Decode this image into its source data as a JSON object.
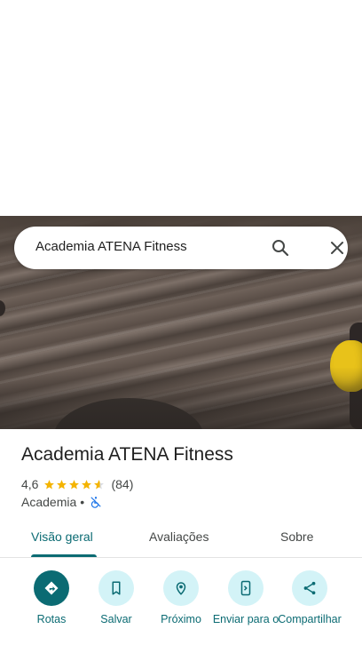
{
  "search": {
    "query": "Academia ATENA Fitness"
  },
  "place": {
    "name": "Academia ATENA Fitness",
    "rating": "4,6",
    "rating_value": 4.6,
    "stars_max": 5,
    "review_count": "(84)",
    "category": "Academia",
    "separator": "•"
  },
  "tabs": [
    {
      "label": "Visão geral",
      "active": true
    },
    {
      "label": "Avaliações",
      "active": false
    },
    {
      "label": "Sobre",
      "active": false
    }
  ],
  "actions": [
    {
      "label": "Rotas",
      "icon": "directions-icon"
    },
    {
      "label": "Salvar",
      "icon": "bookmark-icon"
    },
    {
      "label": "Próximo",
      "icon": "nearby-icon"
    },
    {
      "label": "Enviar para o",
      "icon": "send-to-phone-icon"
    },
    {
      "label": "Compartilhar",
      "icon": "share-icon"
    }
  ],
  "colors": {
    "accent": "#0b6b73",
    "accent_light": "#d3f3f7",
    "star": "#f4b400",
    "no_access": "#1a73e8"
  }
}
